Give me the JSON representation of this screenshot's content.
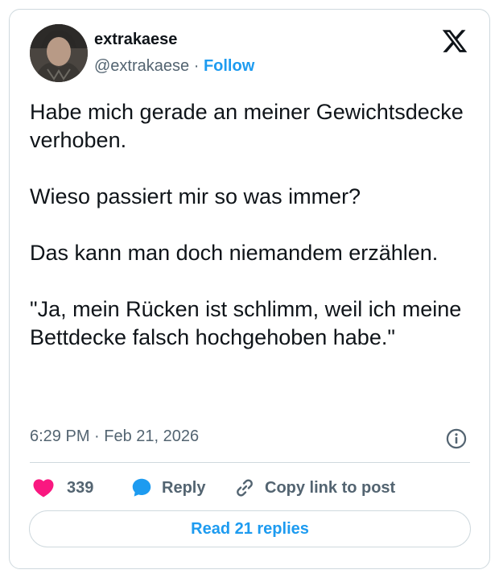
{
  "author": {
    "name": "extrakaese",
    "handle": "@extrakaese",
    "separator": "·",
    "follow_label": "Follow",
    "avatar_icon": "profile-photo-avatar"
  },
  "brand_icon": "x-logo-icon",
  "tweet": {
    "paragraphs": [
      "Habe mich gerade an meiner Gewichtsdecke verhoben.",
      "Wieso passiert mir so was immer?",
      "Das kann man doch niemandem erzählen.",
      "\"Ja, mein Rücken ist schlimm, weil ich meine Bettdecke falsch hochgehoben habe.\""
    ],
    "time": "6:29 PM",
    "date": "Feb 21, 2026",
    "meta_separator": " · "
  },
  "actions": {
    "like_count": "339",
    "reply_label": "Reply",
    "copy_label": "Copy link to post"
  },
  "read_replies_label": "Read 21 replies",
  "colors": {
    "accent": "#1d9bf0",
    "like": "#f91880",
    "text": "#0f1419",
    "muted": "#536471",
    "border": "#cfd9de"
  }
}
